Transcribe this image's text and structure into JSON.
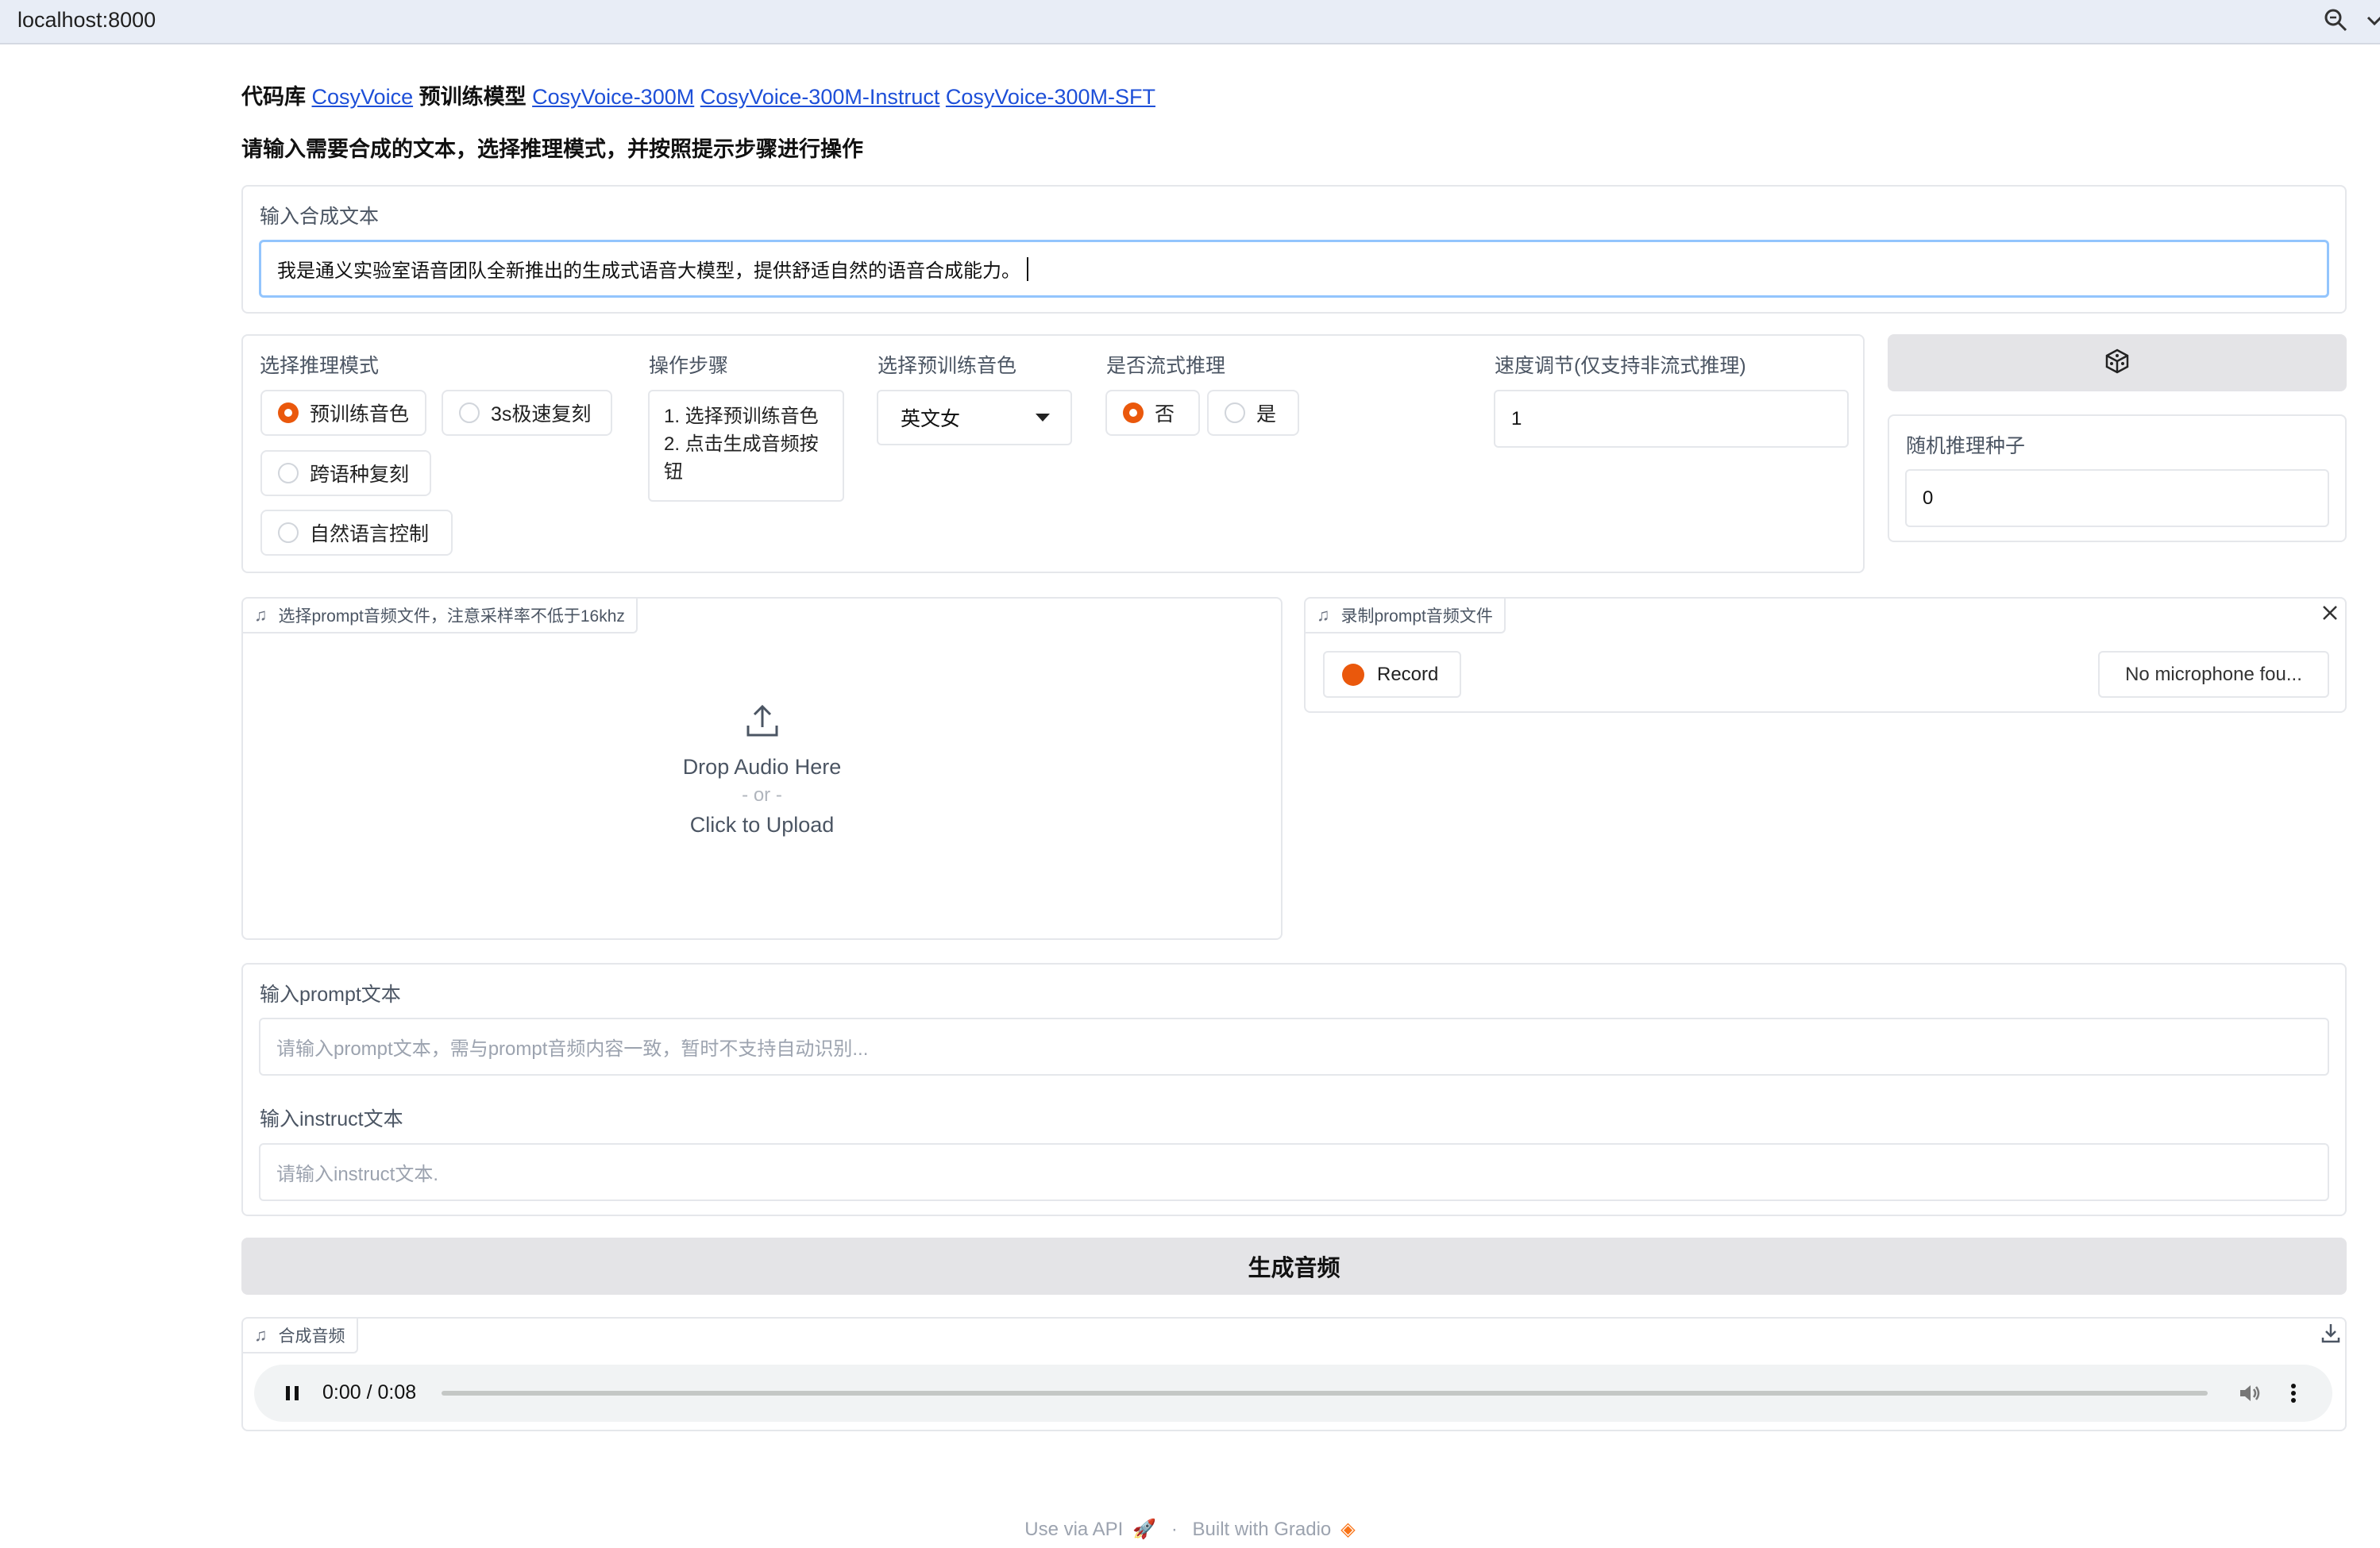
{
  "browser": {
    "url": "localhost:8000"
  },
  "header": {
    "line1": {
      "repo_prefix": "代码库",
      "repo_link": "CosyVoice",
      "models_prefix": "预训练模型",
      "model_links": [
        "CosyVoice-300M",
        "CosyVoice-300M-Instruct",
        "CosyVoice-300M-SFT"
      ]
    },
    "line2": "请输入需要合成的文本，选择推理模式，并按照提示步骤进行操作"
  },
  "tts_text": {
    "label": "输入合成文本",
    "value": "我是通义实验室语音团队全新推出的生成式语音大模型，提供舒适自然的语音合成能力。"
  },
  "mode": {
    "label": "选择推理模式",
    "options": [
      "预训练音色",
      "3s极速复刻",
      "跨语种复刻",
      "自然语言控制"
    ],
    "selected": "预训练音色"
  },
  "steps": {
    "label": "操作步骤",
    "line1": "1. 选择预训练音色",
    "line2": "2. 点击生成音频按钮"
  },
  "voice": {
    "label": "选择预训练音色",
    "selected": "英文女"
  },
  "stream": {
    "label": "是否流式推理",
    "options": [
      "否",
      "是"
    ],
    "selected": "否"
  },
  "speed": {
    "label": "速度调节(仅支持非流式推理)",
    "value": "1"
  },
  "seed": {
    "button_icon": "dice-icon",
    "label": "随机推理种子",
    "value": "0"
  },
  "upload_audio": {
    "tag": "选择prompt音频文件，注意采样率不低于16khz",
    "drop_text": "Drop Audio Here",
    "or_text": "- or -",
    "click_text": "Click to Upload"
  },
  "record_audio": {
    "tag": "录制prompt音频文件",
    "record_label": "Record",
    "mic_text": "No microphone fou..."
  },
  "prompt_text": {
    "label": "输入prompt文本",
    "placeholder": "请输入prompt文本，需与prompt音频内容一致，暂时不支持自动识别..."
  },
  "instruct_text": {
    "label": "输入instruct文本",
    "placeholder": "请输入instruct文本."
  },
  "generate": {
    "label": "生成音频"
  },
  "output_audio": {
    "tag": "合成音频",
    "time": "0:00 / 0:08",
    "progress": 0
  },
  "footer": {
    "api": "Use via API",
    "separator": "·",
    "built": "Built with Gradio"
  },
  "colors": {
    "accent": "#ea580c",
    "link": "#1d4fd8",
    "button_bg": "#e4e4e7",
    "focus_border": "#93c5fd"
  }
}
